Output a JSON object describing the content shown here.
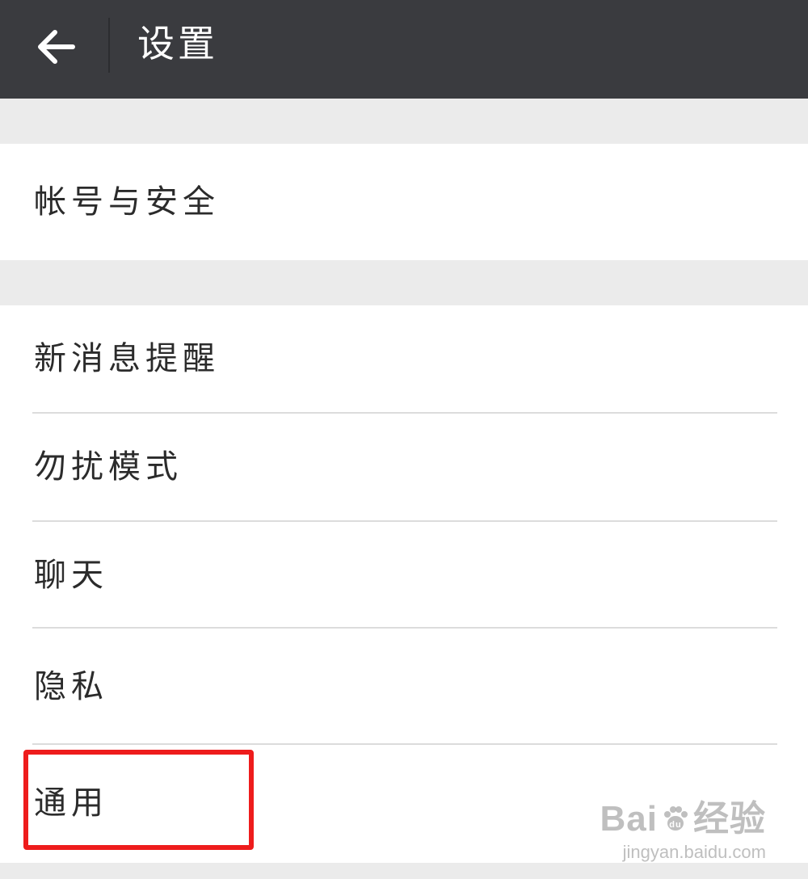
{
  "header": {
    "title": "设置",
    "back_icon": "arrow-left-icon"
  },
  "settings": {
    "account_security": "帐号与安全",
    "new_message_alert": "新消息提醒",
    "do_not_disturb": "勿扰模式",
    "chat": "聊天",
    "privacy": "隐私",
    "general": "通用"
  },
  "watermark": {
    "logo_left": "Bai",
    "logo_right": "经验",
    "paw_text": "du",
    "url": "jingyan.baidu.com"
  },
  "colors": {
    "topbar": "#3a3b3f",
    "background": "#ebebeb",
    "highlight": "#ee1c1c"
  }
}
